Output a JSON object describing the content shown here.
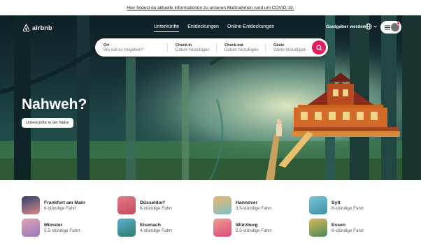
{
  "banner": {
    "text": "Hier findest du aktuelle Informationen zu unseren Maßnahmen rund um COVID-19."
  },
  "header": {
    "logo_text": "airbnb",
    "nav": [
      {
        "label": "Unterkünfte",
        "active": true
      },
      {
        "label": "Entdeckungen",
        "active": false
      },
      {
        "label": "Online-Entdeckungen",
        "active": false
      }
    ],
    "host_label": "Gastgeber werden",
    "language_icon": "globe-icon",
    "menu_icon": "hamburger-icon",
    "notification_color": "#e31c5f"
  },
  "search": {
    "fields": [
      {
        "label": "Ort",
        "value": "Wo soll es hingehen?"
      },
      {
        "label": "Check-in",
        "value": "Datum hinzufügen"
      },
      {
        "label": "Check-out",
        "value": "Datum hinzufügen"
      },
      {
        "label": "Gäste",
        "value": "Gäste hinzufügen"
      }
    ],
    "button_color": "#e31c5f"
  },
  "hero": {
    "headline": "Nahweh?",
    "cta": "Unterkünfte in der Nähe"
  },
  "destinations": [
    {
      "name": "Frankfurt am Main",
      "distance": "6-stündige Fahrt",
      "colors": [
        "#2d3e6e",
        "#d98a8a"
      ]
    },
    {
      "name": "Düsseldorf",
      "distance": "6-stündige Fahrt",
      "colors": [
        "#e07a8a",
        "#c94a5e"
      ]
    },
    {
      "name": "Hannover",
      "distance": "3.5-stündige Fahrt",
      "colors": [
        "#e8b86a",
        "#7ec0c8"
      ]
    },
    {
      "name": "Sylt",
      "distance": "6-stündige Fahrt",
      "colors": [
        "#7cc6d6",
        "#3e8fa8"
      ]
    },
    {
      "name": "Münster",
      "distance": "5.5-stündige Fahrt",
      "colors": [
        "#e3a2b8",
        "#9a78b8"
      ]
    },
    {
      "name": "Eisenach",
      "distance": "4-stündige Fahrt",
      "colors": [
        "#5ab0d0",
        "#2f7a6a"
      ]
    },
    {
      "name": "Würzburg",
      "distance": "5.5-stündige Fahrt",
      "colors": [
        "#f0a090",
        "#d84a7a"
      ]
    },
    {
      "name": "Essen",
      "distance": "6-stündige Fahrt",
      "colors": [
        "#d8b85a",
        "#4a8a5a"
      ]
    }
  ]
}
